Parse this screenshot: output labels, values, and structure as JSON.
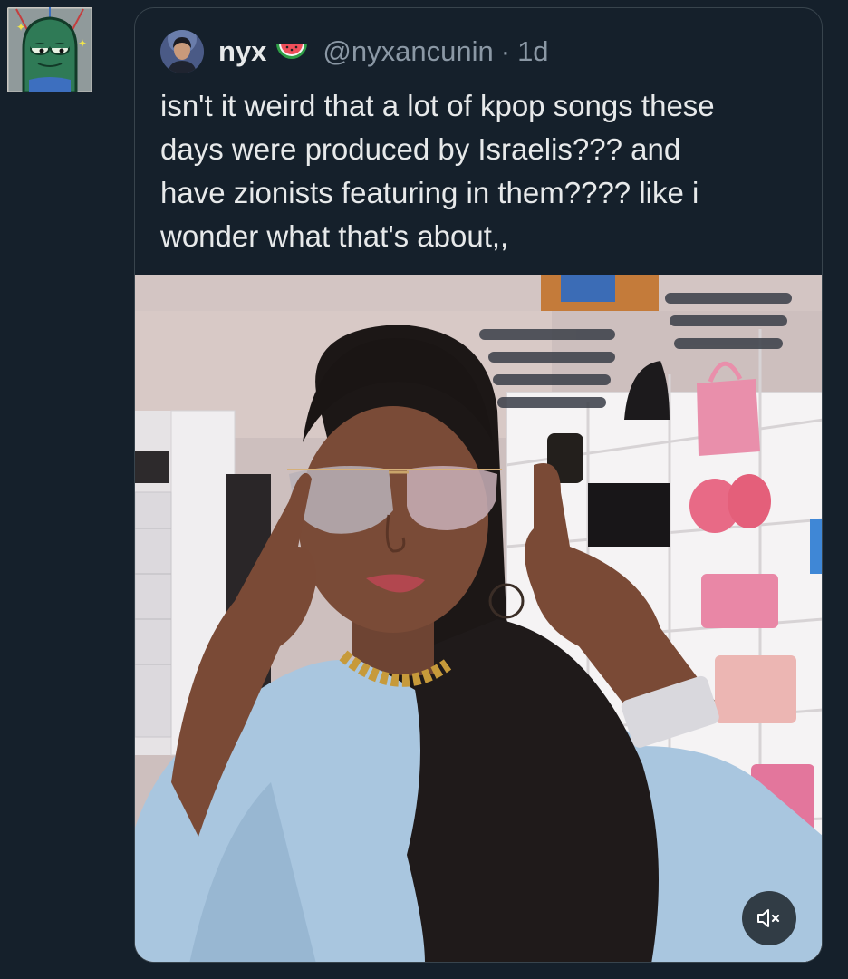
{
  "quoted_tweet": {
    "display_name": "nyx",
    "emoji_icon": "watermelon-icon",
    "handle": "@nyxancunin",
    "separator": "·",
    "time": "1d",
    "text": "isn't it weird that a lot of kpop songs these\ndays were produced by Israelis??? and\nhave zionists featuring in them???? like i\nwonder what that's about,,"
  },
  "media": {
    "type": "video",
    "mute_icon": "speaker-muted-icon"
  },
  "colors": {
    "background": "#15202b",
    "card_border": "#38444d",
    "text_primary": "#e7e9ea",
    "text_secondary": "#8b98a5"
  }
}
